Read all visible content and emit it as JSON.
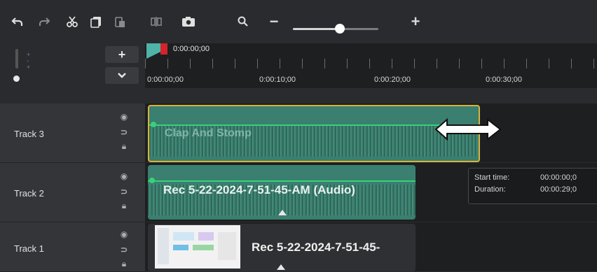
{
  "window_title": "",
  "toolbar": {
    "undo_icon": "undo-icon",
    "redo_icon": "redo-icon",
    "cut_icon": "scissors-icon",
    "copy_icon": "copy-icon",
    "paste_icon": "paste-icon",
    "split_icon": "split-icon",
    "snapshot_icon": "camera-icon",
    "zoom_icon": "magnifier-icon",
    "zoom_out": "−",
    "zoom_in": "+",
    "zoom_level": 0.55
  },
  "left_header": {
    "add_track_label": "+",
    "collapse_label": "⌄"
  },
  "ruler": {
    "playhead_time": "0:00:00;00",
    "tick_labels": [
      "0:00:00;00",
      "0:00:10;00",
      "0:00:20;00",
      "0:00:30;00"
    ]
  },
  "tracks": [
    {
      "name": "Track 3",
      "clip_title": "Clap And Stomp"
    },
    {
      "name": "Track 2",
      "clip_title": "Rec 5-22-2024-7-51-45-AM (Audio)"
    },
    {
      "name": "Track 1",
      "clip_title": "Rec 5-22-2024-7-51-45-"
    }
  ],
  "tooltip": {
    "start_label": "Start time:",
    "start_value": "00:00:00;0",
    "duration_label": "Duration:",
    "duration_value": "00:00:29;0"
  },
  "colors": {
    "accent_teal": "#4fb3a7",
    "playhead_red": "#d4242a",
    "selection_gold": "#d9b43a",
    "volume_green": "#39d07a"
  }
}
